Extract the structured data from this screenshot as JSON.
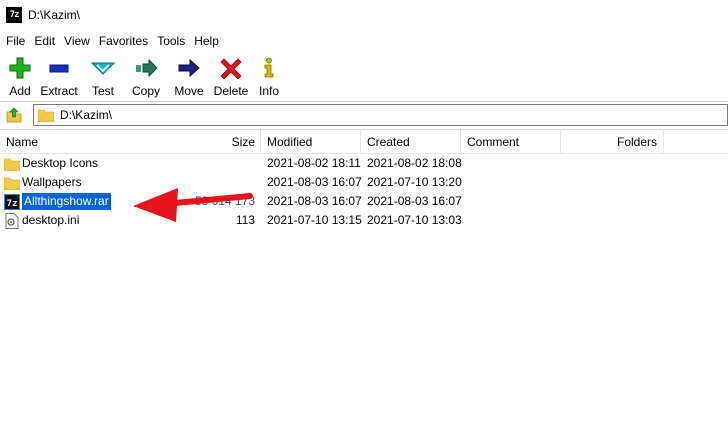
{
  "window": {
    "title": "D:\\Kazim\\",
    "app_icon_text": "7z"
  },
  "menu": [
    "File",
    "Edit",
    "View",
    "Favorites",
    "Tools",
    "Help"
  ],
  "toolbar": [
    {
      "label": "Add",
      "icon": "add-icon",
      "color": "#1db31d"
    },
    {
      "label": "Extract",
      "icon": "extract-icon",
      "color": "#1a2fbf"
    },
    {
      "label": "Test",
      "icon": "test-icon",
      "color": "#19b2c7"
    },
    {
      "label": "Copy",
      "icon": "copy-icon",
      "color": "#1e7a5a"
    },
    {
      "label": "Move",
      "icon": "move-icon",
      "color": "#1a237e"
    },
    {
      "label": "Delete",
      "icon": "delete-icon",
      "color": "#e0141c"
    },
    {
      "label": "Info",
      "icon": "info-icon",
      "color": "#d8b800"
    }
  ],
  "address": {
    "path": "D:\\Kazim\\"
  },
  "columns": {
    "name": "Name",
    "size": "Size",
    "modified": "Modified",
    "created": "Created",
    "comment": "Comment",
    "folders": "Folders"
  },
  "rows": [
    {
      "name": "Desktop Icons",
      "size": "",
      "modified": "2021-08-02 18:11",
      "created": "2021-08-02 18:08",
      "icon": "folder-icon"
    },
    {
      "name": "Wallpapers",
      "size": "",
      "modified": "2021-08-03 16:07",
      "created": "2021-07-10 13:20",
      "icon": "folder-icon"
    },
    {
      "name": "Allthingshow.rar",
      "size": "53 014 173",
      "modified": "2021-08-03 16:07",
      "created": "2021-08-03 16:07",
      "icon": "archive-icon",
      "selected": true
    },
    {
      "name": "desktop.ini",
      "size": "113",
      "modified": "2021-07-10 13:15",
      "created": "2021-07-10 13:03",
      "icon": "ini-file-icon"
    }
  ],
  "annotation": {
    "color": "#e8141c",
    "icon": "red-arrow-annotation"
  }
}
